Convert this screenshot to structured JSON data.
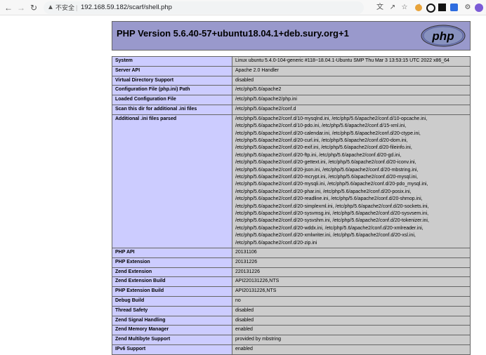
{
  "browser": {
    "security_label": "不安全",
    "separator": "|",
    "url": "192.168.59.182/scarf/shell.php"
  },
  "php_header": {
    "title": "PHP Version 5.6.40-57+ubuntu18.04.1+deb.sury.org+1",
    "logo_text": "php"
  },
  "rows": [
    {
      "label": "System",
      "value": "Linux ubuntu 5.4.0-104-generic #118~18.04.1-Ubuntu SMP Thu Mar 3 13:53:15 UTC 2022 x86_64"
    },
    {
      "label": "Server API",
      "value": "Apache 2.0 Handler"
    },
    {
      "label": "Virtual Directory Support",
      "value": "disabled"
    },
    {
      "label": "Configuration File (php.ini) Path",
      "value": "/etc/php/5.6/apache2"
    },
    {
      "label": "Loaded Configuration File",
      "value": "/etc/php/5.6/apache2/php.ini"
    },
    {
      "label": "Scan this dir for additional .ini files",
      "value": "/etc/php/5.6/apache2/conf.d"
    }
  ],
  "additional_ini": {
    "label": "Additional .ini files parsed",
    "lines": [
      "/etc/php/5.6/apache2/conf.d/10-mysqlnd.ini, /etc/php/5.6/apache2/conf.d/10-opcache.ini,",
      "/etc/php/5.6/apache2/conf.d/10-pdo.ini, /etc/php/5.6/apache2/conf.d/15-xml.ini,",
      "/etc/php/5.6/apache2/conf.d/20-calendar.ini, /etc/php/5.6/apache2/conf.d/20-ctype.ini,",
      "/etc/php/5.6/apache2/conf.d/20-curl.ini, /etc/php/5.6/apache2/conf.d/20-dom.ini,",
      "/etc/php/5.6/apache2/conf.d/20-exif.ini, /etc/php/5.6/apache2/conf.d/20-fileinfo.ini,",
      "/etc/php/5.6/apache2/conf.d/20-ftp.ini, /etc/php/5.6/apache2/conf.d/20-gd.ini,",
      "/etc/php/5.6/apache2/conf.d/20-gettext.ini, /etc/php/5.6/apache2/conf.d/20-iconv.ini,",
      "/etc/php/5.6/apache2/conf.d/20-json.ini, /etc/php/5.6/apache2/conf.d/20-mbstring.ini,",
      "/etc/php/5.6/apache2/conf.d/20-mcrypt.ini, /etc/php/5.6/apache2/conf.d/20-mysql.ini,",
      "/etc/php/5.6/apache2/conf.d/20-mysqli.ini, /etc/php/5.6/apache2/conf.d/20-pdo_mysql.ini,",
      "/etc/php/5.6/apache2/conf.d/20-phar.ini, /etc/php/5.6/apache2/conf.d/20-posix.ini,",
      "/etc/php/5.6/apache2/conf.d/20-readline.ini, /etc/php/5.6/apache2/conf.d/20-shmop.ini,",
      "/etc/php/5.6/apache2/conf.d/20-simplexml.ini, /etc/php/5.6/apache2/conf.d/20-sockets.ini,",
      "/etc/php/5.6/apache2/conf.d/20-sysvmsg.ini, /etc/php/5.6/apache2/conf.d/20-sysvsem.ini,",
      "/etc/php/5.6/apache2/conf.d/20-sysvshm.ini, /etc/php/5.6/apache2/conf.d/20-tokenizer.ini,",
      "/etc/php/5.6/apache2/conf.d/20-wddx.ini, /etc/php/5.6/apache2/conf.d/20-xmlreader.ini,",
      "/etc/php/5.6/apache2/conf.d/20-xmlwriter.ini, /etc/php/5.6/apache2/conf.d/20-xsl.ini,",
      "/etc/php/5.6/apache2/conf.d/20-zip.ini"
    ]
  },
  "rows2": [
    {
      "label": "PHP API",
      "value": "20131106"
    },
    {
      "label": "PHP Extension",
      "value": "20131226"
    },
    {
      "label": "Zend Extension",
      "value": "220131226"
    },
    {
      "label": "Zend Extension Build",
      "value": "API220131226,NTS"
    },
    {
      "label": "PHP Extension Build",
      "value": "API20131226,NTS"
    },
    {
      "label": "Debug Build",
      "value": "no"
    },
    {
      "label": "Thread Safety",
      "value": "disabled"
    },
    {
      "label": "Zend Signal Handling",
      "value": "disabled"
    },
    {
      "label": "Zend Memory Manager",
      "value": "enabled"
    },
    {
      "label": "Zend Multibyte Support",
      "value": "provided by mbstring"
    },
    {
      "label": "IPv6 Support",
      "value": "enabled"
    }
  ]
}
